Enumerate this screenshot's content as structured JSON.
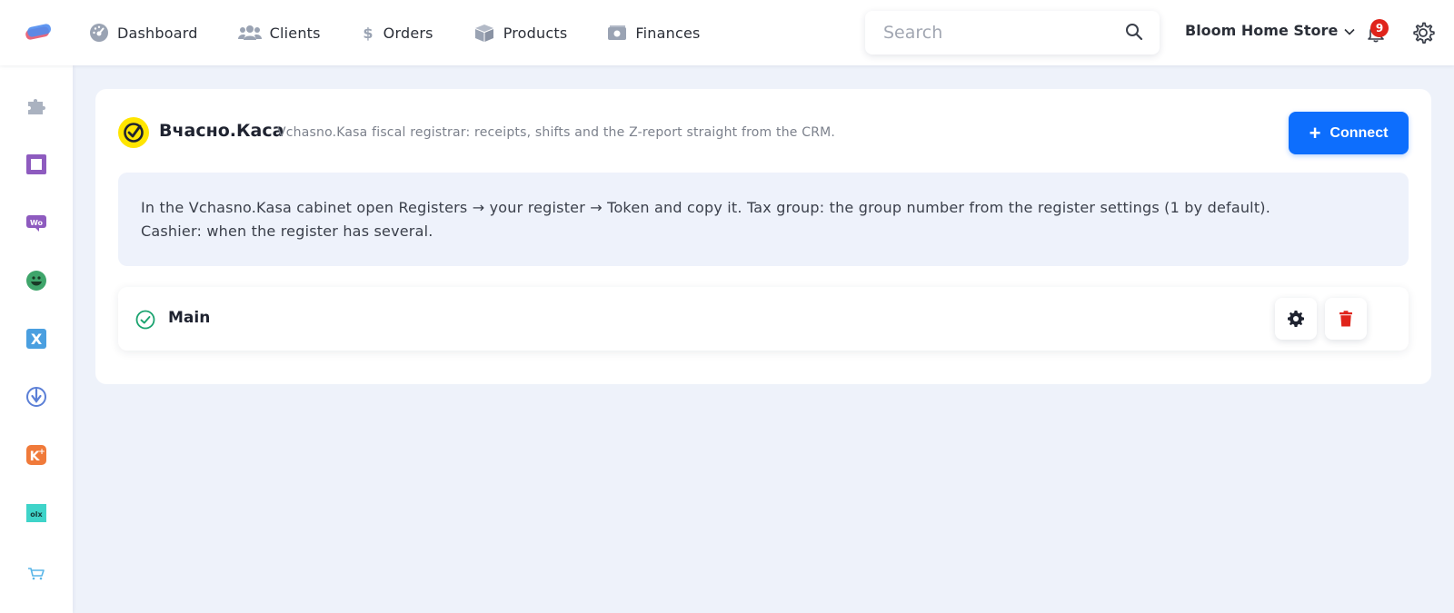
{
  "nav": {
    "items": [
      {
        "label": "Dashboard",
        "icon": "dashboard-icon"
      },
      {
        "label": "Clients",
        "icon": "users-icon"
      },
      {
        "label": "Orders",
        "icon": "dollar-icon"
      },
      {
        "label": "Products",
        "icon": "box-icon"
      },
      {
        "label": "Finances",
        "icon": "money-icon"
      }
    ]
  },
  "search": {
    "placeholder": "Search",
    "value": ""
  },
  "store": {
    "name": "Bloom Home Store"
  },
  "notifications": {
    "count": "9"
  },
  "sidebar": {
    "icons": [
      "puzzle-icon",
      "square-app-icon",
      "woo-icon",
      "smile-app-icon",
      "x-app-icon",
      "arrow-circle-app-icon",
      "k-plus-app-icon",
      "olx-icon",
      "cart-icon"
    ]
  },
  "integration": {
    "title": "Вчасно.Каса",
    "subtitle": "Vchasno.Kasa fiscal registrar: receipts, shifts and the Z-report straight from the CRM.",
    "connect_label": "Connect",
    "info_line1": "In the Vchasno.Kasa cabinet open Registers → your register → Token and copy it. Tax group: the group number from the register settings (1 by default).",
    "info_line2": "Cashier: when the register has several.",
    "register": {
      "name": "Main",
      "status": "active"
    }
  },
  "colors": {
    "accent": "#0d6efd",
    "danger": "#e0241b",
    "success": "#1aa36f",
    "background": "#eef2fa"
  }
}
